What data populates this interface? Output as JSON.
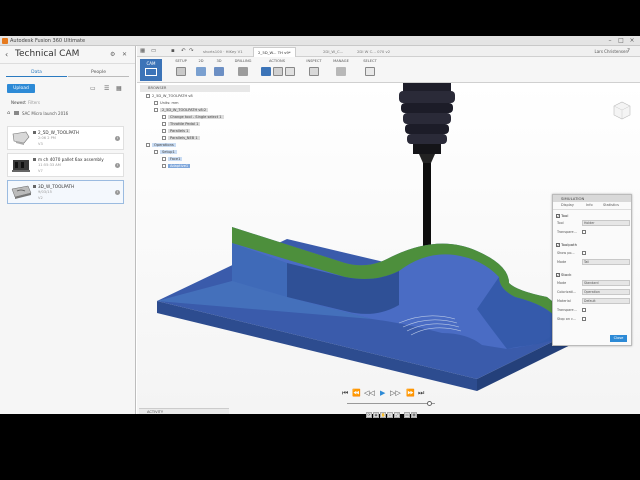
{
  "window": {
    "title": "Autodesk Fusion 360 Ultimate"
  },
  "left_panel": {
    "project_name": "Technical CAM",
    "tabs": [
      "Data",
      "People"
    ],
    "upload_label": "Upload",
    "filter_label": "Newest",
    "filter_hint": "Filters",
    "breadcrumb": "SAC Micro launch 2016",
    "files": [
      {
        "name": "2_5D_W_TOOLPATH",
        "meta": "2:06 2 PM",
        "version": "V3"
      },
      {
        "name": "m ch 4070 pallet 6ax assembly",
        "meta": "11:55:33 AM",
        "version": "V7"
      },
      {
        "name": "3D_W_TOOLPATH",
        "meta": "9/03/15",
        "version": "V2"
      }
    ]
  },
  "topbar": {
    "tabs": [
      "shorts100 · HiKey V1",
      "2_5D_W... TH v9*",
      "2DI_W_C...",
      "2DI W C... 070 v2"
    ],
    "user": "Lars Christensen"
  },
  "ribbon": {
    "workspace": "CAM",
    "groups": [
      "SETUP",
      "2D",
      "3D",
      "DRILLING",
      "ACTIONS",
      "INSPECT",
      "MANAGE",
      "SELECT"
    ]
  },
  "browser": {
    "title": "BROWSER",
    "items": [
      {
        "label": "2_5D_W_TOOLPATH v8",
        "indent": 1
      },
      {
        "label": "Units: mm",
        "indent": 2
      },
      {
        "label": "2_5D_W_TOOLPATH v8:2",
        "indent": 2
      },
      {
        "label": "Change tool - Single select 1",
        "indent": 3
      },
      {
        "label": "Throttle Pedal 1",
        "indent": 3
      },
      {
        "label": "Parallels 1",
        "indent": 3
      },
      {
        "label": "Parallels_NEB 1",
        "indent": 3
      },
      {
        "label": "Operations",
        "indent": 1
      },
      {
        "label": "Setup1",
        "indent": 2
      },
      {
        "label": "Face1",
        "indent": 3
      },
      {
        "label": "Adaptive1",
        "indent": 3
      }
    ]
  },
  "simulation": {
    "title": "SIMULATION",
    "tabs": [
      "Display",
      "Info",
      "Statistics"
    ],
    "tool_section": "Tool",
    "tool_rows": [
      {
        "key": "Tool",
        "value": "Holder"
      },
      {
        "key": "Transpare...",
        "value": ""
      }
    ],
    "toolpath_section": "Toolpath",
    "toolpath_rows": [
      {
        "key": "Show po...",
        "value": ""
      },
      {
        "key": "Mode",
        "value": "Tail"
      }
    ],
    "stock_section": "Stock",
    "stock_rows": [
      {
        "key": "Mode",
        "value": "Standard"
      },
      {
        "key": "Colorizati...",
        "value": "Operation"
      },
      {
        "key": "Material",
        "value": "Default"
      },
      {
        "key": "Transpare...",
        "value": ""
      },
      {
        "key": "Stop on c...",
        "value": ""
      }
    ],
    "close_label": "Close"
  },
  "activity": {
    "label": "ACTIVITY"
  },
  "colors": {
    "accent": "#2d8ad6",
    "stock_blue": "#2e4f9a",
    "stock_green": "#3e8a3e"
  }
}
